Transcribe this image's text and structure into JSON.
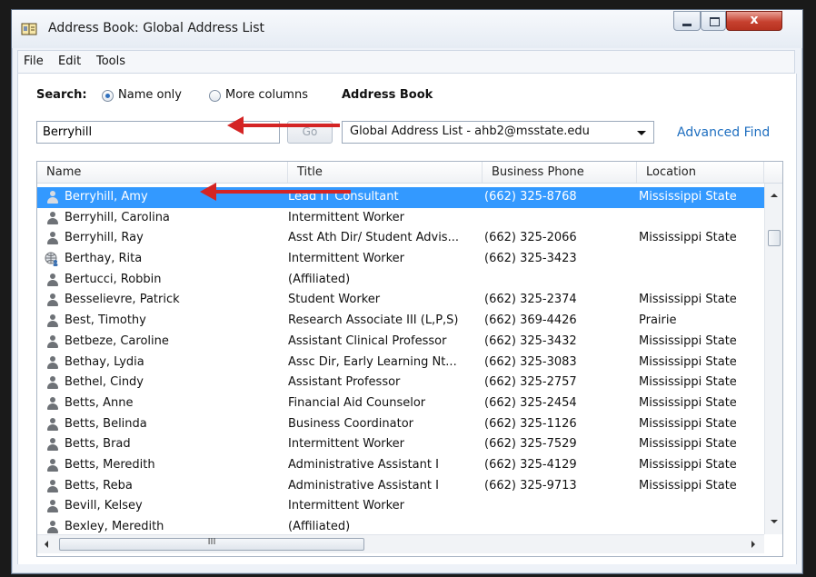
{
  "window": {
    "title": "Address Book: Global Address List",
    "close_glyph": "x"
  },
  "menu": [
    "File",
    "Edit",
    "Tools"
  ],
  "search": {
    "label": "Search:",
    "option_name_only": "Name only",
    "option_more_columns": "More columns",
    "value": "Berryhill",
    "go_label": "Go"
  },
  "address_book": {
    "label": "Address Book",
    "selected": "Global Address List - ahb2@msstate.edu",
    "advanced_find": "Advanced Find"
  },
  "columns": [
    "Name",
    "Title",
    "Business Phone",
    "Location"
  ],
  "rows": [
    {
      "name": "Berryhill, Amy",
      "title": "Lead IT Consultant",
      "phone": "(662) 325-8768",
      "location": "Mississippi State",
      "icon": "person-icon",
      "selected": true
    },
    {
      "name": "Berryhill, Carolina",
      "title": "Intermittent Worker",
      "phone": "",
      "location": "",
      "icon": "person-icon"
    },
    {
      "name": "Berryhill, Ray",
      "title": "Asst Ath Dir/ Student Advis...",
      "phone": "(662) 325-2066",
      "location": "Mississippi State",
      "icon": "person-icon"
    },
    {
      "name": "Berthay, Rita",
      "title": "Intermittent Worker",
      "phone": "(662) 325-3423",
      "location": "",
      "icon": "globe-user-icon"
    },
    {
      "name": "Bertucci, Robbin",
      "title": "(Affiliated)",
      "phone": "",
      "location": "",
      "icon": "person-icon"
    },
    {
      "name": "Besselievre, Patrick",
      "title": "Student Worker",
      "phone": "(662) 325-2374",
      "location": "Mississippi State",
      "icon": "person-icon"
    },
    {
      "name": "Best, Timothy",
      "title": "Research Associate III (L,P,S)",
      "phone": "(662) 369-4426",
      "location": "Prairie",
      "icon": "person-icon"
    },
    {
      "name": "Betbeze, Caroline",
      "title": "Assistant Clinical Professor",
      "phone": "(662) 325-3432",
      "location": "Mississippi State",
      "icon": "person-icon"
    },
    {
      "name": "Bethay, Lydia",
      "title": "Assc Dir, Early Learning Nt...",
      "phone": "(662) 325-3083",
      "location": "Mississippi State",
      "icon": "person-icon"
    },
    {
      "name": "Bethel, Cindy",
      "title": "Assistant Professor",
      "phone": "(662) 325-2757",
      "location": "Mississippi State",
      "icon": "person-icon"
    },
    {
      "name": "Betts, Anne",
      "title": "Financial Aid Counselor",
      "phone": "(662) 325-2454",
      "location": "Mississippi State",
      "icon": "person-icon"
    },
    {
      "name": "Betts, Belinda",
      "title": "Business Coordinator",
      "phone": "(662) 325-1126",
      "location": "Mississippi State",
      "icon": "person-icon"
    },
    {
      "name": "Betts, Brad",
      "title": "Intermittent Worker",
      "phone": "(662) 325-7529",
      "location": "Mississippi State",
      "icon": "person-icon"
    },
    {
      "name": "Betts, Meredith",
      "title": "Administrative Assistant I",
      "phone": "(662) 325-4129",
      "location": "Mississippi State",
      "icon": "person-icon"
    },
    {
      "name": "Betts, Reba",
      "title": "Administrative Assistant I",
      "phone": "(662) 325-9713",
      "location": "Mississippi State",
      "icon": "person-icon"
    },
    {
      "name": "Bevill, Kelsey",
      "title": "Intermittent Worker",
      "phone": "",
      "location": "",
      "icon": "person-icon"
    },
    {
      "name": "Bexley, Meredith",
      "title": "(Affiliated)",
      "phone": "",
      "location": "",
      "icon": "person-icon"
    }
  ],
  "scrollbar_grip": "III",
  "colors": {
    "selection": "#3399ff",
    "link": "#1f6fc0",
    "annotation_arrow": "#d42424"
  }
}
